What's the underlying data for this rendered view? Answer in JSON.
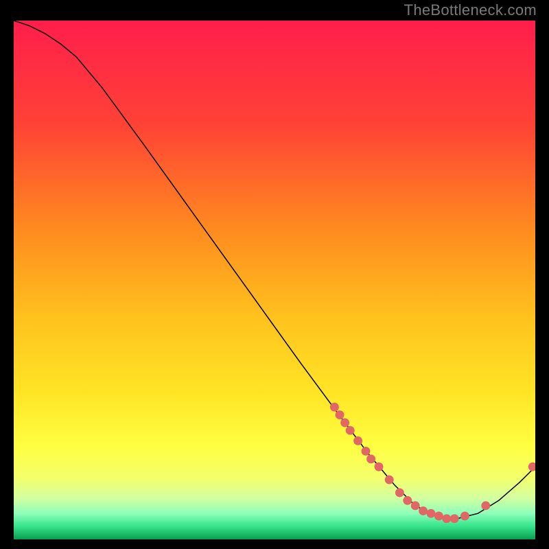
{
  "title": "TheBottleneck.com",
  "chart_data": {
    "type": "line",
    "title": "TheBottleneck.com",
    "xlabel": "",
    "ylabel": "",
    "xlim": [
      0,
      1
    ],
    "ylim": [
      0,
      1
    ],
    "note": "No axis ticks or numeric labels are visible; x/y are normalised 0–1. Curve y-values read as fraction from bottom (0) to top (1). Colour gradient encodes value: top=red (high), bottom=green (low).",
    "series": [
      {
        "name": "curve",
        "x": [
          0.0,
          0.03,
          0.06,
          0.09,
          0.12,
          0.17,
          0.25,
          0.35,
          0.45,
          0.55,
          0.62,
          0.68,
          0.73,
          0.77,
          0.81,
          0.85,
          0.89,
          0.93,
          0.97,
          1.0
        ],
        "y": [
          1.0,
          0.99,
          0.975,
          0.955,
          0.93,
          0.87,
          0.76,
          0.62,
          0.48,
          0.34,
          0.245,
          0.165,
          0.105,
          0.065,
          0.045,
          0.04,
          0.05,
          0.075,
          0.11,
          0.14
        ]
      }
    ],
    "points": {
      "name": "markers",
      "x": [
        0.615,
        0.625,
        0.635,
        0.645,
        0.66,
        0.675,
        0.685,
        0.7,
        0.72,
        0.74,
        0.755,
        0.77,
        0.785,
        0.8,
        0.815,
        0.83,
        0.845,
        0.865,
        0.905,
        0.995
      ],
      "y": [
        0.255,
        0.24,
        0.225,
        0.21,
        0.19,
        0.17,
        0.155,
        0.14,
        0.115,
        0.09,
        0.075,
        0.065,
        0.055,
        0.05,
        0.045,
        0.04,
        0.04,
        0.045,
        0.065,
        0.14
      ]
    },
    "gradient_stops": [
      {
        "pos": 0.0,
        "color": "#ff1e4b"
      },
      {
        "pos": 0.2,
        "color": "#ff4236"
      },
      {
        "pos": 0.4,
        "color": "#ff8a1f"
      },
      {
        "pos": 0.58,
        "color": "#ffc41e"
      },
      {
        "pos": 0.72,
        "color": "#ffe526"
      },
      {
        "pos": 0.82,
        "color": "#ffff41"
      },
      {
        "pos": 0.88,
        "color": "#f4ff6a"
      },
      {
        "pos": 0.92,
        "color": "#d4ffa0"
      },
      {
        "pos": 0.95,
        "color": "#8dffba"
      },
      {
        "pos": 0.975,
        "color": "#35e48a"
      },
      {
        "pos": 1.0,
        "color": "#0a9e4f"
      }
    ]
  }
}
